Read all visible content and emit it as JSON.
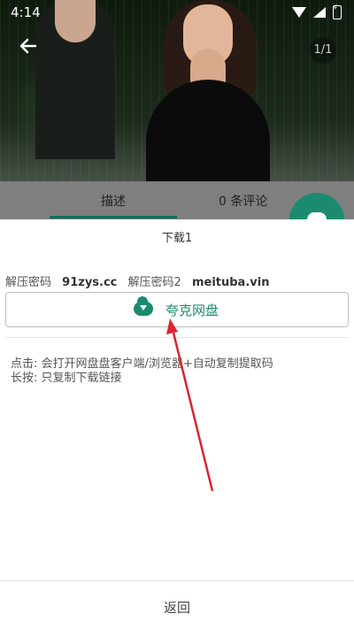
{
  "status_bar": {
    "time": "4:14"
  },
  "viewer": {
    "pager": "1/1"
  },
  "tabs": {
    "tab1": "描述",
    "tab2": "0 条评论"
  },
  "sheet": {
    "title": "下载1",
    "password_label_1": "解压密码",
    "password_value_1": "91zys.cc",
    "password_label_2": "解压密码2",
    "password_value_2": "meituba.vin",
    "download_button_label": "夸克网盘",
    "hint_click": "点击: 会打开网盘盘客户端/浏览器+自动复制提取码",
    "hint_long_press": "长按: 只复制下载链接",
    "return_label": "返回"
  },
  "colors": {
    "accent": "#1b8b70",
    "arrow": "#d9262f"
  },
  "icons": [
    "back-arrow-icon",
    "wifi-icon",
    "signal-icon",
    "battery-icon",
    "cloud-download-icon"
  ]
}
